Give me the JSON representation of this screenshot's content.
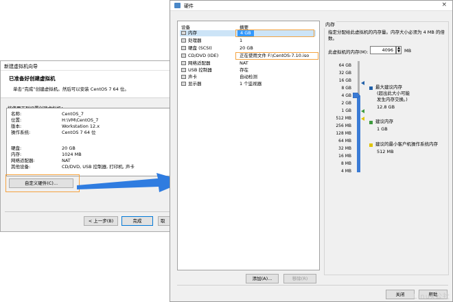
{
  "wizard": {
    "title": "新建虚拟机向导",
    "heading": "已准备好创建虚拟机",
    "description": "单击“完成”创建虚拟机。然后可以安装 CentOS 7 64 位。",
    "instruction": "将使用下列设置创建虚拟机：",
    "summary": [
      {
        "label": "名称:",
        "value": "CentOS_7"
      },
      {
        "label": "位置:",
        "value": "H:\\VM\\CentOS_7"
      },
      {
        "label": "版本:",
        "value": "Workstation 12.x"
      },
      {
        "label": "操作系统:",
        "value": "CentOS 7 64 位"
      },
      {
        "label": "硬盘:",
        "value": "20 GB"
      },
      {
        "label": "内存:",
        "value": "1024 MB"
      },
      {
        "label": "网络适配器:",
        "value": "NAT"
      },
      {
        "label": "其他设备:",
        "value": "CD/DVD, USB 控制器, 打印机, 声卡"
      }
    ],
    "customize_label": "自定义硬件(C)...",
    "back_label": "< 上一步(B)",
    "finish_label": "完成",
    "cancel_label": "取"
  },
  "hardware": {
    "title": "硬件",
    "close_glyph": "×",
    "columns": {
      "device": "设备",
      "summary": "摘要"
    },
    "devices": [
      {
        "icon": "memory-icon",
        "name": "内存",
        "summary": "4 GB",
        "selected": true
      },
      {
        "icon": "cpu-icon",
        "name": "处理器",
        "summary": "1"
      },
      {
        "icon": "disk-icon",
        "name": "硬盘 (SCSI)",
        "summary": "20 GB"
      },
      {
        "icon": "cd-dvd-icon",
        "name": "CD/DVD (IDE)",
        "summary": "正在使用文件 F:\\CentOS-7.10.iso"
      },
      {
        "icon": "network-icon",
        "name": "网络适配器",
        "summary": "NAT"
      },
      {
        "icon": "usb-icon",
        "name": "USB 控制器",
        "summary": "存在"
      },
      {
        "icon": "sound-icon",
        "name": "声卡",
        "summary": "自动检测"
      },
      {
        "icon": "display-icon",
        "name": "显示器",
        "summary": "1 个监视器"
      }
    ],
    "add_label": "添加(A)...",
    "remove_label": "移除(R)",
    "close_label": "关闭",
    "help_label": "帮助"
  },
  "memory": {
    "group_title": "内存",
    "description": "指定分配给此虚拟机的内存量。内存大小必须为 4 MB 的倍数。",
    "input_label": "此虚拟机的内存(M):",
    "value": "4096",
    "unit": "MB",
    "ticks": [
      "64 GB",
      "32 GB",
      "16 GB",
      "8 GB",
      "4 GB",
      "2 GB",
      "1 GB",
      "512 MB",
      "256 MB",
      "128 MB",
      "64 MB",
      "32 MB",
      "16 MB",
      "8 MB",
      "4 MB"
    ],
    "legend": [
      {
        "color": "#1f5fa8",
        "label": "最大建议内存",
        "note": "(超出此大小可能\n发生内存交换。)",
        "value": "12.8 GB"
      },
      {
        "color": "#3e9a3e",
        "label": "建议内存",
        "value": "1 GB"
      },
      {
        "color": "#e0c400",
        "label": "建议的最小客户机操作系统内存",
        "value": "512 MB"
      }
    ]
  },
  "watermark": "Linux公社"
}
